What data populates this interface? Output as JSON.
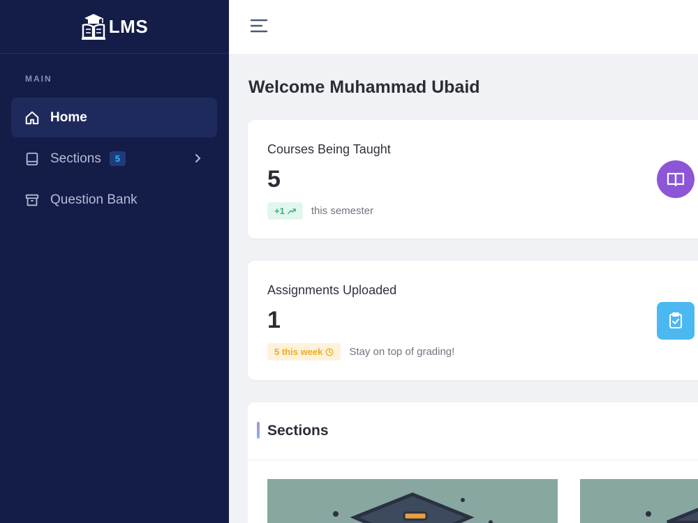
{
  "brand": {
    "name": "LMS"
  },
  "sidebar": {
    "section_label": "MAIN",
    "items": [
      {
        "label": "Home",
        "icon": "home-icon",
        "active": true
      },
      {
        "label": "Sections",
        "icon": "book-icon",
        "badge": "5"
      },
      {
        "label": "Question Bank",
        "icon": "archive-icon"
      }
    ]
  },
  "main": {
    "title": "Welcome Muhammad Ubaid",
    "cards": [
      {
        "title": "Courses Being Taught",
        "value": "5",
        "pill": "+1",
        "footer": "this semester",
        "icon": "open-book-icon",
        "color": "#8c56d6"
      },
      {
        "title": "Assignments Uploaded",
        "value": "1",
        "pill": "5 this week",
        "footer": "Stay on top of grading!",
        "icon": "clipboard-check-icon",
        "color": "#4cb8f2"
      }
    ],
    "sections_title": "Sections"
  },
  "colors": {
    "sidebar_bg": "#141c48",
    "accent_green": "#2fb57e",
    "accent_yellow": "#efaa25"
  }
}
